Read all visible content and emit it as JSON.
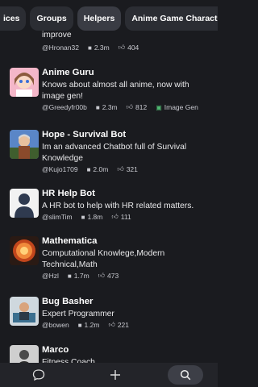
{
  "tabs": [
    "ices",
    "Groups",
    "Helpers",
    "Anime Game Characters"
  ],
  "partial_top": {
    "desc": "improve",
    "author": "@Hronan32",
    "messages": "2.3m",
    "likes": "404"
  },
  "bots": [
    {
      "title": "Anime Guru",
      "desc": "Knows about almost all anime, now with image gen!",
      "author": "@Greedyfr00b",
      "messages": "2.3m",
      "likes": "812",
      "badge": "Image Gen"
    },
    {
      "title": "Hope - Survival Bot",
      "desc": "Im an advanced Chatbot full of Survival Knowledge",
      "author": "@Kujo1709",
      "messages": "2.0m",
      "likes": "321"
    },
    {
      "title": "HR Help Bot",
      "desc": "A HR bot to help with HR related matters.",
      "author": "@slimTim",
      "messages": "1.8m",
      "likes": "111"
    },
    {
      "title": "Mathematica",
      "desc": "Computational Knowlege,Modern Technical,Math",
      "author": "@Hzl",
      "messages": "1.7m",
      "likes": "473"
    },
    {
      "title": "Bug Basher",
      "desc": "Expert Programmer",
      "author": "@bowen",
      "messages": "1.2m",
      "likes": "221"
    },
    {
      "title": "Marco",
      "desc": "Fitness Coach"
    }
  ],
  "nav": [
    "chat-icon",
    "plus-icon",
    "search-icon"
  ],
  "colors": {
    "bg": "#1a1b1f",
    "tab": "#2b2d33",
    "badge_green": "#4fb870"
  }
}
